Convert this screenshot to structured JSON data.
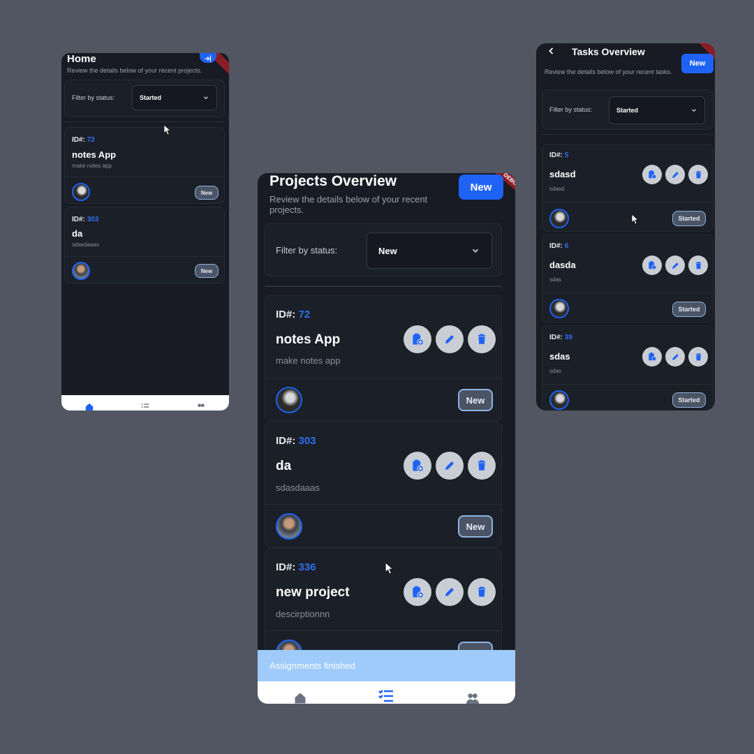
{
  "left": {
    "title": "Home",
    "subtitle": "Review the details below of your recent projects.",
    "filter_label": "Filter by status:",
    "filter_value": "Started",
    "cards": [
      {
        "id_label": "ID#:",
        "id": "72",
        "title": "notes App",
        "desc": "make notes app",
        "badge": "New"
      },
      {
        "id_label": "ID#:",
        "id": "303",
        "title": "da",
        "desc": "sdasdaaas",
        "badge": "New"
      }
    ]
  },
  "center": {
    "title": "Projects Overview",
    "subtitle": "Review the details below of your recent projects.",
    "new_label": "New",
    "ribbon": "DEBUG",
    "filter_label": "Filter by status:",
    "filter_value": "New",
    "cards": [
      {
        "id_label": "ID#:",
        "id": "72",
        "title": "notes App",
        "desc": "make notes app",
        "badge": "New"
      },
      {
        "id_label": "ID#:",
        "id": "303",
        "title": "da",
        "desc": "sdasdaaas",
        "badge": "New"
      },
      {
        "id_label": "ID#:",
        "id": "336",
        "title": "new project",
        "desc": "descirptionnn",
        "badge": "New"
      }
    ],
    "toast": "Assignments finished"
  },
  "right": {
    "title": "Tasks Overview",
    "subtitle": "Review the details below of your recent tasks.",
    "new_label": "New",
    "filter_label": "Filter by status:",
    "filter_value": "Started",
    "cards": [
      {
        "id_label": "ID#:",
        "id": "5",
        "title": "sdasd",
        "desc": "sdasd",
        "badge": "Started"
      },
      {
        "id_label": "ID#:",
        "id": "6",
        "title": "dasda",
        "desc": "sdas",
        "badge": "Started"
      },
      {
        "id_label": "ID#:",
        "id": "39",
        "title": "sdas",
        "desc": "sdas",
        "badge": "Started"
      }
    ]
  },
  "colors": {
    "background": "#525663",
    "panel": "#181b23",
    "accent": "#1f63f6",
    "toast": "#9ecbfa"
  }
}
